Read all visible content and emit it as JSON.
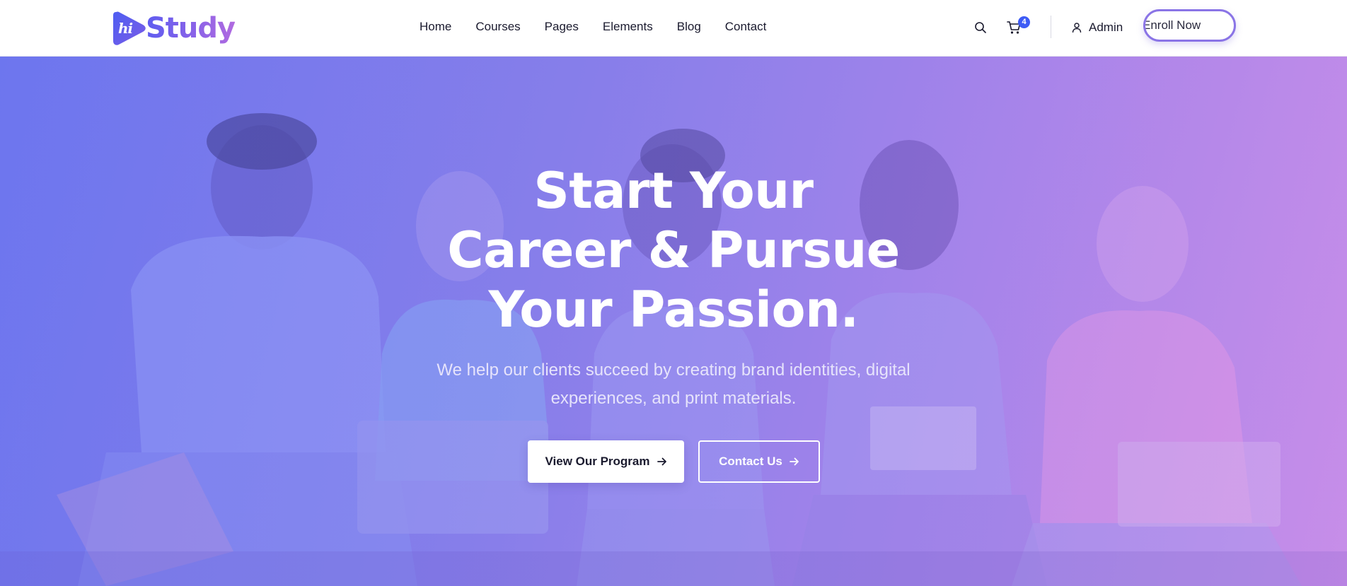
{
  "header": {
    "logo": {
      "mark_text": "hi",
      "brand": "Study"
    },
    "nav": [
      "Home",
      "Courses",
      "Pages",
      "Elements",
      "Blog",
      "Contact"
    ],
    "cart_count": "4",
    "user_label": "Admin",
    "enroll_label": "Enroll Now"
  },
  "hero": {
    "title_lines": [
      "Start Your",
      "Career & Pursue",
      "Your Passion."
    ],
    "subtitle_lines": [
      "We help our clients succeed by creating brand identities, digital",
      "experiences, and print materials."
    ],
    "primary_button": "View Our Program",
    "secondary_button": "Contact Us"
  },
  "colors": {
    "brand": "#5e5cf0",
    "accent": "#b06ae0",
    "badge": "#3d5bf5",
    "enroll_border": "#8a74e6"
  },
  "icons": [
    "search-icon",
    "cart-icon",
    "user-icon",
    "arrow-right-icon"
  ]
}
